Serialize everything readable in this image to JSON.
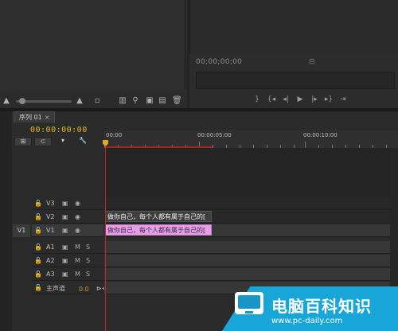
{
  "monitor": {
    "timecode": "00;00;00;00",
    "timecode_right": "⊟"
  },
  "timeline": {
    "tab_label": "序列 01",
    "tab_close": "×",
    "timecode": "00:00:00:00",
    "ruler_labels": [
      "00:00",
      "00:00:05:00",
      "00:00:10:00"
    ],
    "tracks": [
      {
        "name": "V3",
        "type": "video"
      },
      {
        "name": "V2",
        "type": "video"
      },
      {
        "name": "V1",
        "type": "video"
      },
      {
        "name": "A1",
        "type": "audio"
      },
      {
        "name": "A2",
        "type": "audio"
      },
      {
        "name": "A3",
        "type": "audio"
      }
    ],
    "master_label": "主声道",
    "master_value": "0.0",
    "v1_target": "V1",
    "clip_v2_text": "做你自己，每个人都有属于自己的[",
    "clip_v1_text": "做你自己，每个人都有属于自己的[",
    "mute_label": "M",
    "solo_label": "S"
  },
  "watermark": {
    "title": "电脑百科知识",
    "url": "www.pc-daily.com"
  },
  "colors": {
    "timecode": "#e8b820",
    "playhead": "#cc2222",
    "clip_v1": "#e79ee8",
    "watermark": "#18a6d8"
  }
}
